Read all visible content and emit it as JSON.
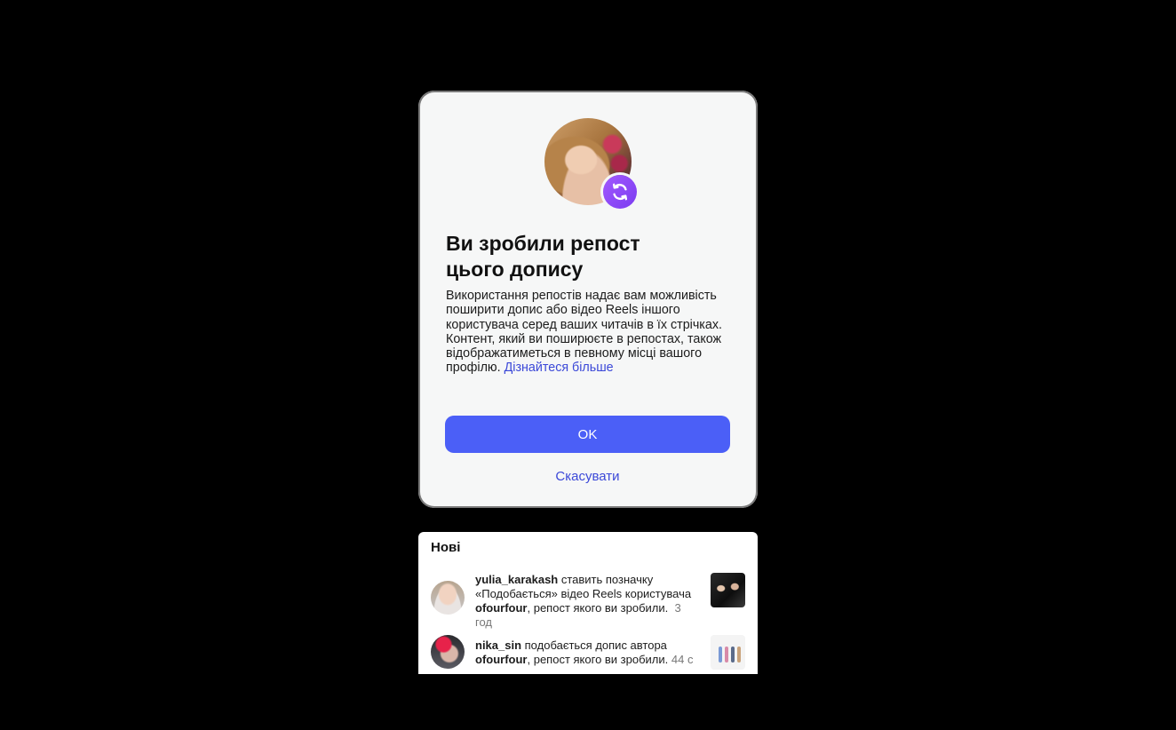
{
  "modal": {
    "title": "Ви зробили репост цього допису",
    "body": "Використання репостів надає вам можливість поширити допис або відео Reels іншого користувача серед ваших читачів в їх стрічках. Контент, який ви поширюєте в репостах, також відображатиметься в певному місці вашого профілю.",
    "learn_more": "Дізнайтеся більше",
    "ok_label": "OK",
    "cancel_label": "Скасувати",
    "badge_icon": "repost-icon",
    "accent_color": "#4b5ff7",
    "link_color": "#3b48d8"
  },
  "notifications": {
    "heading": "Нові",
    "items": [
      {
        "user": "yulia_karakash",
        "text1": " ставить позначку «Подобається» відео Reels користувача ",
        "owner": "ofourfour",
        "text2": ", репост якого ви зробили.",
        "time": "3 год"
      },
      {
        "user": "nika_sin",
        "text1": " подобається допис автора ",
        "owner": "ofourfour",
        "text2": ", репост якого ви зробили.",
        "time": "44 с"
      }
    ]
  }
}
